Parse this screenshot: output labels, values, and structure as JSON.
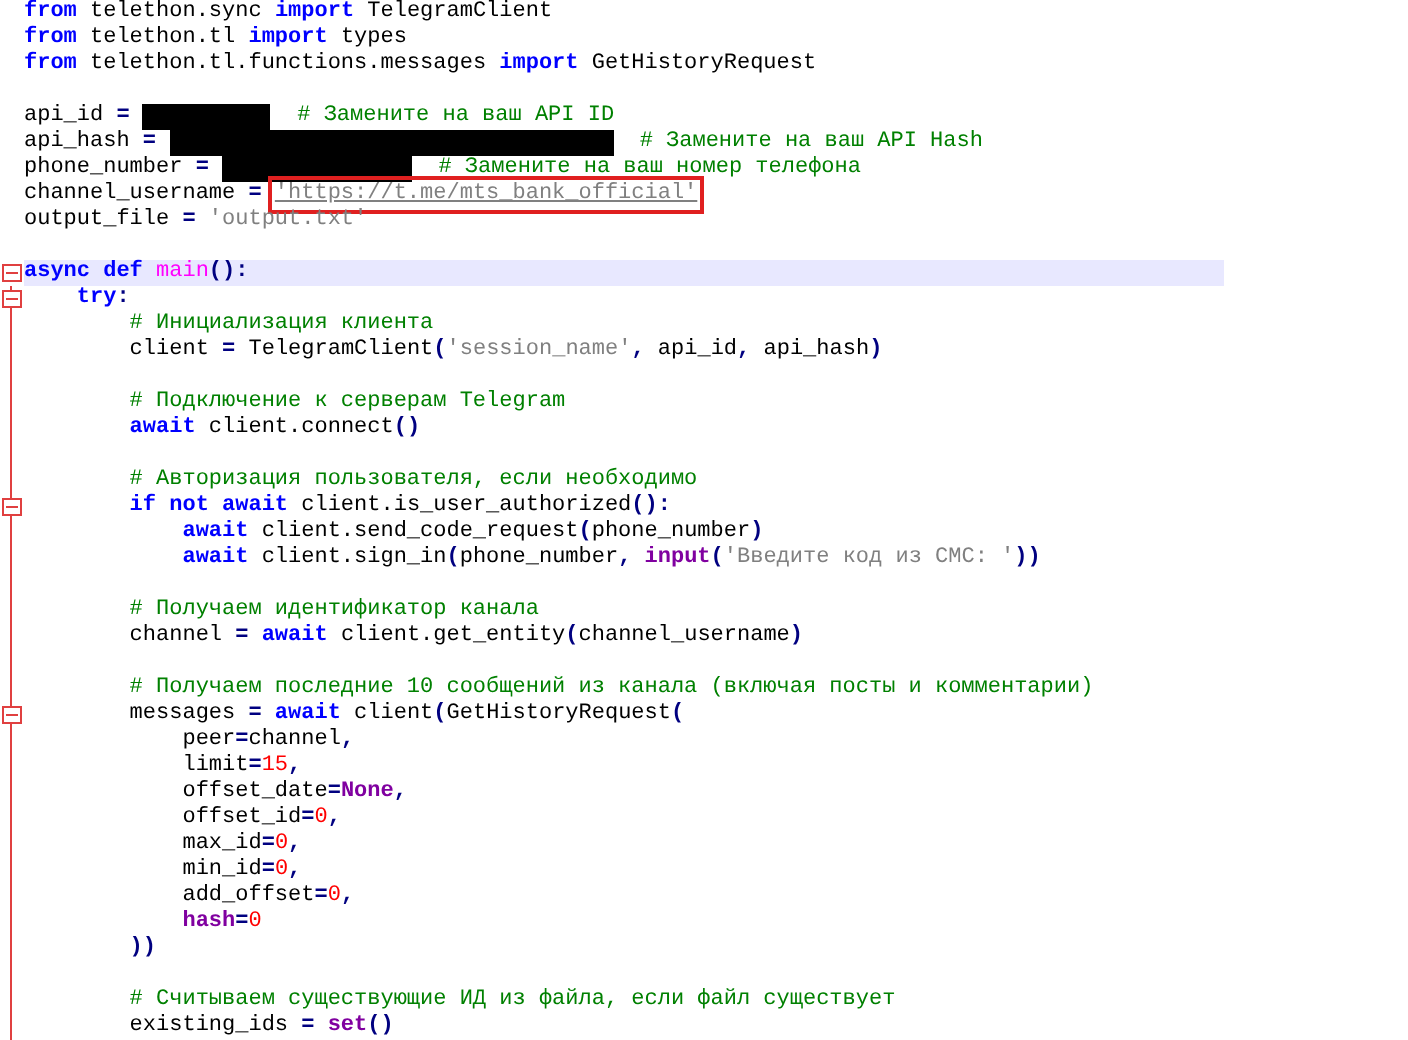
{
  "editor": {
    "lines": [
      {
        "kind": "code",
        "tokens": [
          {
            "kind": "kw",
            "text": "from"
          },
          {
            "kind": "plain",
            "text": " telethon.sync "
          },
          {
            "kind": "kw",
            "text": "import"
          },
          {
            "kind": "plain",
            "text": " TelegramClient"
          }
        ]
      },
      {
        "kind": "code",
        "tokens": [
          {
            "kind": "kw",
            "text": "from"
          },
          {
            "kind": "plain",
            "text": " telethon.tl "
          },
          {
            "kind": "kw",
            "text": "import"
          },
          {
            "kind": "plain",
            "text": " types"
          }
        ]
      },
      {
        "kind": "code",
        "tokens": [
          {
            "kind": "kw",
            "text": "from"
          },
          {
            "kind": "plain",
            "text": " telethon.tl.functions.messages "
          },
          {
            "kind": "kw",
            "text": "import"
          },
          {
            "kind": "plain",
            "text": " GetHistoryRequest"
          }
        ]
      },
      {
        "kind": "blank"
      },
      {
        "kind": "code",
        "tokens": [
          {
            "kind": "plain",
            "text": "api_id "
          },
          {
            "kind": "op",
            "text": "= "
          },
          {
            "kind": "redacted"
          },
          {
            "kind": "comment",
            "text": "  # Замените на ваш API ID"
          }
        ]
      },
      {
        "kind": "code",
        "tokens": [
          {
            "kind": "plain",
            "text": "api_hash "
          },
          {
            "kind": "op",
            "text": "= "
          },
          {
            "kind": "redacted"
          },
          {
            "kind": "comment",
            "text": "  # Замените на ваш API Hash"
          }
        ]
      },
      {
        "kind": "code",
        "tokens": [
          {
            "kind": "plain",
            "text": "phone_number "
          },
          {
            "kind": "op",
            "text": "= "
          },
          {
            "kind": "redacted"
          },
          {
            "kind": "comment",
            "text": "  # Замените на ваш номер телефона"
          }
        ]
      },
      {
        "kind": "code",
        "tokens": [
          {
            "kind": "plain",
            "text": "channel_username "
          },
          {
            "kind": "op",
            "text": "= "
          },
          {
            "kind": "str",
            "text": "'https://t.me/mts_bank_official'",
            "boxed": true
          }
        ]
      },
      {
        "kind": "code",
        "tokens": [
          {
            "kind": "plain",
            "text": "output_file "
          },
          {
            "kind": "op",
            "text": "= "
          },
          {
            "kind": "str",
            "text": "'output.txt'"
          }
        ]
      },
      {
        "kind": "blank"
      },
      {
        "kind": "code",
        "fold": true,
        "current": true,
        "tokens": [
          {
            "kind": "kw",
            "text": "async def "
          },
          {
            "kind": "fn",
            "text": "main"
          },
          {
            "kind": "op",
            "text": "():"
          }
        ]
      },
      {
        "kind": "code",
        "fold": true,
        "tokens": [
          {
            "kind": "kw",
            "text": "    try"
          },
          {
            "kind": "op",
            "text": ":"
          }
        ]
      },
      {
        "kind": "code",
        "tokens": [
          {
            "kind": "comment",
            "text": "        # Инициализация клиента"
          }
        ]
      },
      {
        "kind": "code",
        "tokens": [
          {
            "kind": "plain",
            "text": "        client "
          },
          {
            "kind": "op",
            "text": "="
          },
          {
            "kind": "plain",
            "text": " TelegramClient"
          },
          {
            "kind": "op",
            "text": "("
          },
          {
            "kind": "str",
            "text": "'session_name'"
          },
          {
            "kind": "op",
            "text": ","
          },
          {
            "kind": "plain",
            "text": " api_id"
          },
          {
            "kind": "op",
            "text": ","
          },
          {
            "kind": "plain",
            "text": " api_hash"
          },
          {
            "kind": "op",
            "text": ")"
          }
        ]
      },
      {
        "kind": "blank"
      },
      {
        "kind": "code",
        "tokens": [
          {
            "kind": "comment",
            "text": "        # Подключение к серверам Telegram"
          }
        ]
      },
      {
        "kind": "code",
        "tokens": [
          {
            "kind": "kw",
            "text": "        await"
          },
          {
            "kind": "plain",
            "text": " client.connect"
          },
          {
            "kind": "op",
            "text": "()"
          }
        ]
      },
      {
        "kind": "blank"
      },
      {
        "kind": "code",
        "tokens": [
          {
            "kind": "comment",
            "text": "        # Авторизация пользователя, если необходимо"
          }
        ]
      },
      {
        "kind": "code",
        "fold": true,
        "tokens": [
          {
            "kind": "kw",
            "text": "        if not await"
          },
          {
            "kind": "plain",
            "text": " client.is_user_authorized"
          },
          {
            "kind": "op",
            "text": "():"
          }
        ]
      },
      {
        "kind": "code",
        "tokens": [
          {
            "kind": "kw",
            "text": "            await"
          },
          {
            "kind": "plain",
            "text": " client.send_code_request"
          },
          {
            "kind": "op",
            "text": "("
          },
          {
            "kind": "plain",
            "text": "phone_number"
          },
          {
            "kind": "op",
            "text": ")"
          }
        ]
      },
      {
        "kind": "code",
        "tokens": [
          {
            "kind": "kw",
            "text": "            await"
          },
          {
            "kind": "plain",
            "text": " client.sign_in"
          },
          {
            "kind": "op",
            "text": "("
          },
          {
            "kind": "plain",
            "text": "phone_number"
          },
          {
            "kind": "op",
            "text": ", "
          },
          {
            "kind": "builtin",
            "text": "input"
          },
          {
            "kind": "op",
            "text": "("
          },
          {
            "kind": "str",
            "text": "'Введите код из СМС: '"
          },
          {
            "kind": "op",
            "text": "))"
          }
        ]
      },
      {
        "kind": "blank"
      },
      {
        "kind": "code",
        "tokens": [
          {
            "kind": "comment",
            "text": "        # Получаем идентификатор канала"
          }
        ]
      },
      {
        "kind": "code",
        "tokens": [
          {
            "kind": "plain",
            "text": "        channel "
          },
          {
            "kind": "op",
            "text": "= "
          },
          {
            "kind": "kw",
            "text": "await"
          },
          {
            "kind": "plain",
            "text": " client.get_entity"
          },
          {
            "kind": "op",
            "text": "("
          },
          {
            "kind": "plain",
            "text": "channel_username"
          },
          {
            "kind": "op",
            "text": ")"
          }
        ]
      },
      {
        "kind": "blank"
      },
      {
        "kind": "code",
        "tokens": [
          {
            "kind": "comment",
            "text": "        # Получаем последние 10 сообщений из канала (включая посты и комментарии)"
          }
        ]
      },
      {
        "kind": "code",
        "fold": true,
        "tokens": [
          {
            "kind": "plain",
            "text": "        messages "
          },
          {
            "kind": "op",
            "text": "= "
          },
          {
            "kind": "kw",
            "text": "await"
          },
          {
            "kind": "plain",
            "text": " client"
          },
          {
            "kind": "op",
            "text": "("
          },
          {
            "kind": "plain",
            "text": "GetHistoryRequest"
          },
          {
            "kind": "op",
            "text": "("
          }
        ]
      },
      {
        "kind": "code",
        "tokens": [
          {
            "kind": "plain",
            "text": "            peer"
          },
          {
            "kind": "op",
            "text": "="
          },
          {
            "kind": "plain",
            "text": "channel"
          },
          {
            "kind": "op",
            "text": ","
          }
        ]
      },
      {
        "kind": "code",
        "tokens": [
          {
            "kind": "plain",
            "text": "            limit"
          },
          {
            "kind": "op",
            "text": "="
          },
          {
            "kind": "num",
            "text": "15"
          },
          {
            "kind": "op",
            "text": ","
          }
        ]
      },
      {
        "kind": "code",
        "tokens": [
          {
            "kind": "plain",
            "text": "            offset_date"
          },
          {
            "kind": "op",
            "text": "="
          },
          {
            "kind": "builtin",
            "text": "None"
          },
          {
            "kind": "op",
            "text": ","
          }
        ]
      },
      {
        "kind": "code",
        "tokens": [
          {
            "kind": "plain",
            "text": "            offset_id"
          },
          {
            "kind": "op",
            "text": "="
          },
          {
            "kind": "num",
            "text": "0"
          },
          {
            "kind": "op",
            "text": ","
          }
        ]
      },
      {
        "kind": "code",
        "tokens": [
          {
            "kind": "plain",
            "text": "            max_id"
          },
          {
            "kind": "op",
            "text": "="
          },
          {
            "kind": "num",
            "text": "0"
          },
          {
            "kind": "op",
            "text": ","
          }
        ]
      },
      {
        "kind": "code",
        "tokens": [
          {
            "kind": "plain",
            "text": "            min_id"
          },
          {
            "kind": "op",
            "text": "="
          },
          {
            "kind": "num",
            "text": "0"
          },
          {
            "kind": "op",
            "text": ","
          }
        ]
      },
      {
        "kind": "code",
        "tokens": [
          {
            "kind": "plain",
            "text": "            add_offset"
          },
          {
            "kind": "op",
            "text": "="
          },
          {
            "kind": "num",
            "text": "0"
          },
          {
            "kind": "op",
            "text": ","
          }
        ]
      },
      {
        "kind": "code",
        "tokens": [
          {
            "kind": "builtin",
            "text": "            hash"
          },
          {
            "kind": "op",
            "text": "="
          },
          {
            "kind": "num",
            "text": "0"
          }
        ]
      },
      {
        "kind": "code",
        "tokens": [
          {
            "kind": "op",
            "text": "        ))"
          }
        ]
      },
      {
        "kind": "blank"
      },
      {
        "kind": "code",
        "tokens": [
          {
            "kind": "comment",
            "text": "        # Считываем существующие ИД из файла, если файл существует"
          }
        ]
      },
      {
        "kind": "code",
        "tokens": [
          {
            "kind": "plain",
            "text": "        existing_ids "
          },
          {
            "kind": "op",
            "text": "= "
          },
          {
            "kind": "builtin",
            "text": "set"
          },
          {
            "kind": "op",
            "text": "()"
          }
        ]
      }
    ]
  }
}
